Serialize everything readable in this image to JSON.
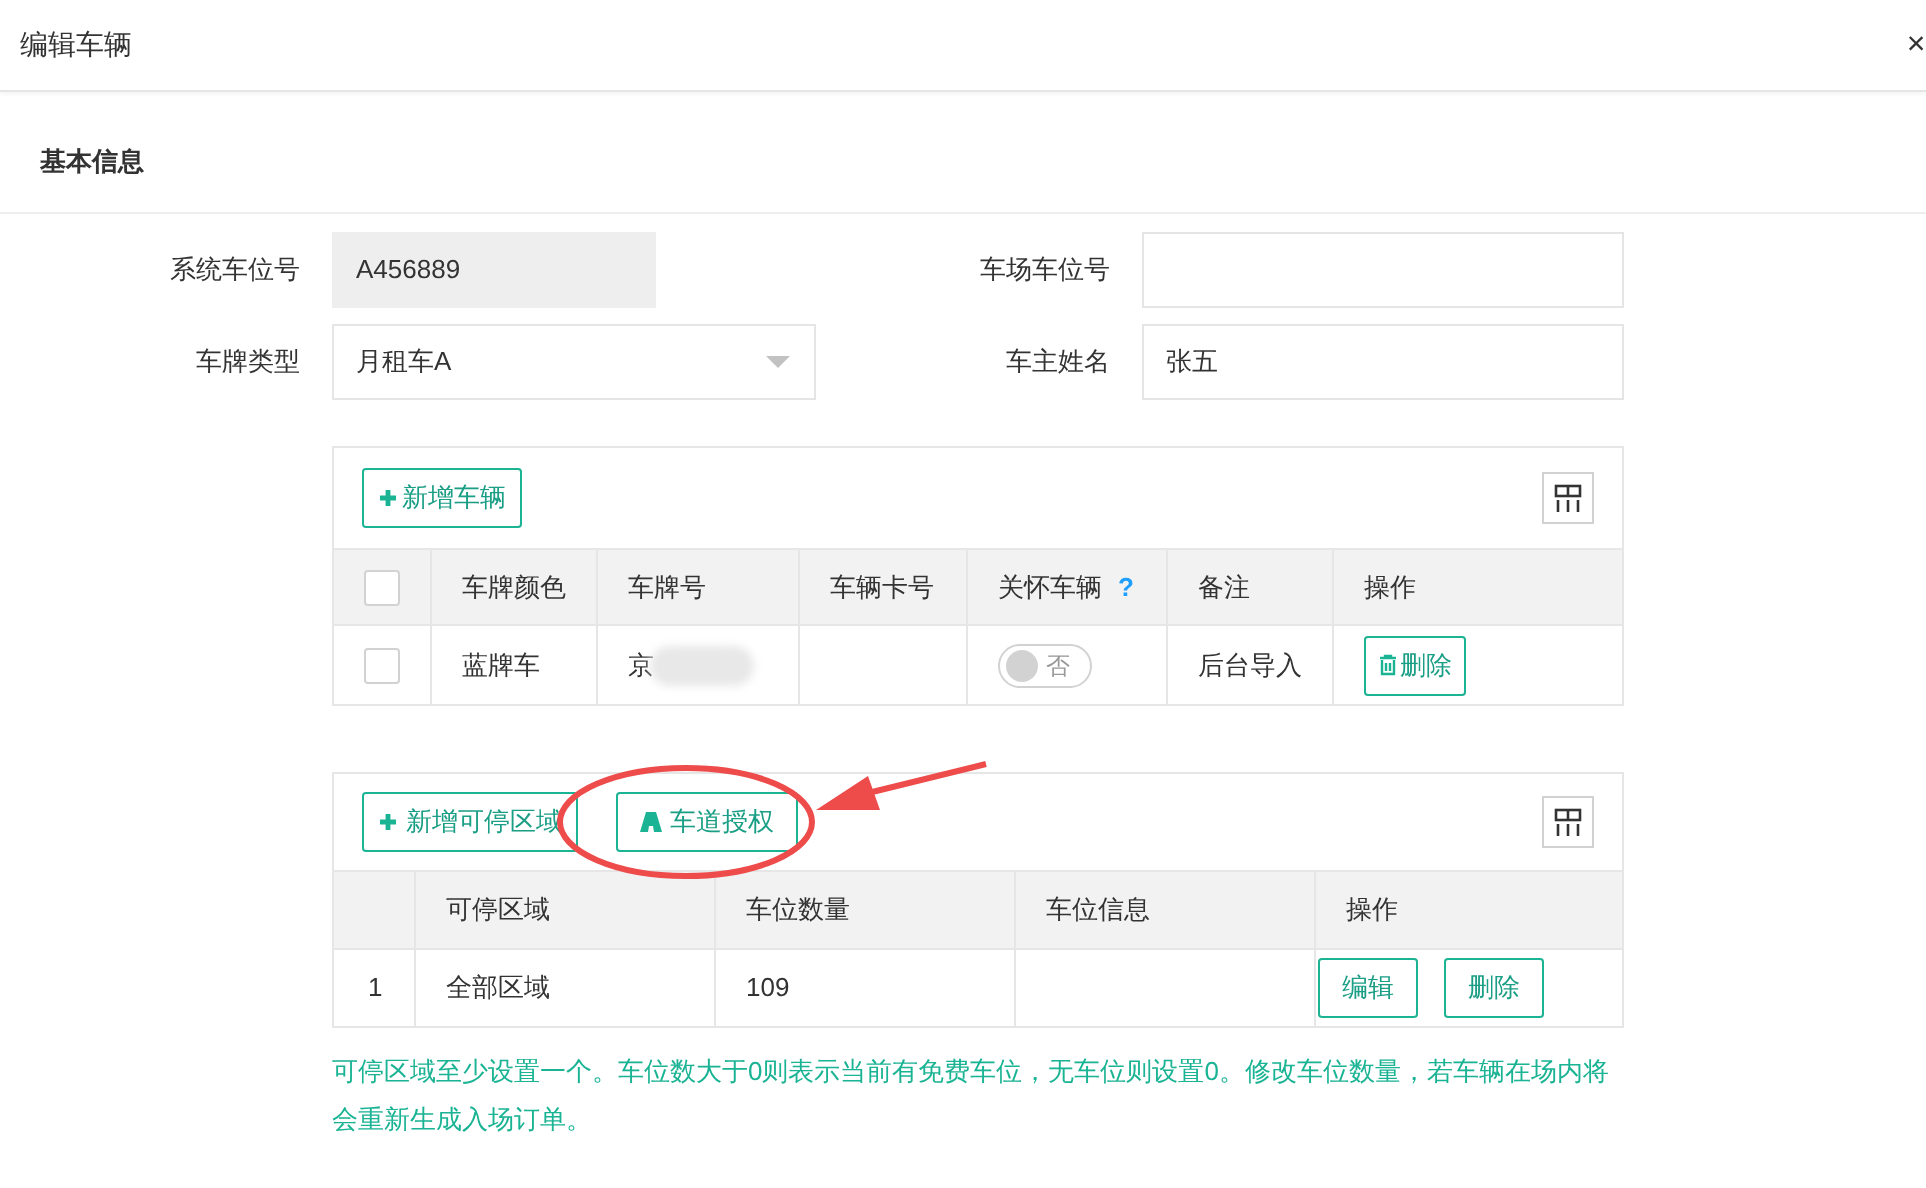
{
  "dialog": {
    "title": "编辑车辆",
    "close": "×"
  },
  "section_title": "基本信息",
  "form": [
    {
      "label": "系统车位号",
      "kind": "text",
      "value": "A456889",
      "disabled": true
    },
    {
      "label": "车场车位号",
      "kind": "text",
      "disabled": false
    },
    {
      "label": "车牌类型",
      "kind": "select",
      "value": "月租车A",
      "disabled": false
    },
    {
      "label": "车主姓名",
      "kind": "text",
      "value": "张五",
      "disabled": false
    }
  ],
  "vehicles": {
    "add_button": "新增车辆",
    "all_checked": false,
    "columns": [
      "车牌颜色",
      "车牌号",
      "车辆卡号",
      "关怀车辆",
      "备注",
      "操作"
    ],
    "help": "?",
    "rows": [
      {
        "checked": false,
        "plate_color": "蓝牌车",
        "plate_number": "京",
        "care": false,
        "care_label": "否",
        "note": "后台导入",
        "delete_button": "删除"
      }
    ]
  },
  "zones": {
    "buttons": [
      "新增可停区域",
      "车道授权"
    ],
    "columns": [
      "可停区域",
      "车位数量",
      "车位信息",
      "操作"
    ],
    "rows": [
      {
        "index": "1",
        "zone": "全部区域",
        "count": "109",
        "actions": [
          "编辑",
          "删除"
        ]
      }
    ]
  },
  "hint": "可停区域至少设置一个。车位数大于0则表示当前有免费车位，无车位则设置0。修改车位数量，若车辆在场内将会重新生成入场订单。"
}
